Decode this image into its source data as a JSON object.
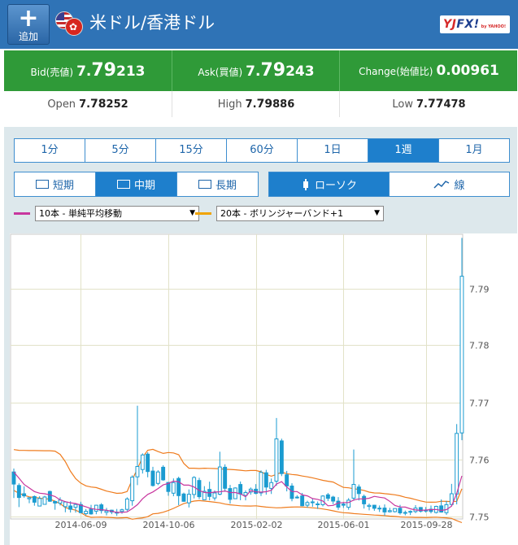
{
  "header": {
    "add_label": "追加",
    "pair_title": "米ドル/香港ドル",
    "logo_a": "YJ",
    "logo_b": "FX!",
    "logo_sub": "by YAHOO!"
  },
  "quotes": {
    "bid_label": "Bid(売値)",
    "bid_prefix": "7.",
    "bid_big": "79",
    "bid_suffix": "213",
    "ask_label": "Ask(買値)",
    "ask_prefix": "7.",
    "ask_big": "79",
    "ask_suffix": "243",
    "change_label": "Change(始値比)",
    "change_value": "0.00961"
  },
  "ohl": {
    "open_label": "Open",
    "open_prefix": "7.",
    "open_big": "78",
    "open_suffix": "252",
    "high_label": "High",
    "high_prefix": "7.",
    "high_big": "79",
    "high_suffix": "886",
    "low_label": "Low",
    "low_prefix": "7.",
    "low_big": "77",
    "low_suffix": "478"
  },
  "timeframes": [
    "1分",
    "5分",
    "15分",
    "60分",
    "1日",
    "1週",
    "1月"
  ],
  "active_timeframe": "1週",
  "range_buttons": [
    "短期",
    "中期",
    "長期"
  ],
  "active_range": "中期",
  "chart_type_buttons": [
    "ローソク",
    "線"
  ],
  "active_chart_type": "ローソク",
  "indicators": {
    "ind1": {
      "label": "10本 - 単純平均移動",
      "color": "#c8369e"
    },
    "ind2": {
      "label": "20本 - ボリンジャーバンド+1",
      "color": "#f0a400"
    }
  },
  "chart_data": {
    "type": "candlestick",
    "x_tick_labels": [
      "2014-06-09",
      "2014-10-06",
      "2015-02-02",
      "2015-06-01",
      "2015-09-28"
    ],
    "y_tick_labels": [
      "7.79",
      "7.78",
      "7.77",
      "7.76",
      "7.75"
    ],
    "y_ticks": [
      7.79,
      7.78,
      7.77,
      7.76,
      7.75
    ],
    "ylim": [
      7.7495,
      7.7995
    ],
    "x_count": 88,
    "colors": {
      "candle": "#1a9bd0",
      "sma": "#c8369e",
      "band": "#ef7c1e",
      "grid": "#e2e2c8"
    },
    "candles": [
      [
        7.75776,
        7.75563,
        7.75317,
        7.75835
      ],
      [
        7.75538,
        7.75326,
        7.75159,
        7.75576
      ],
      [
        7.75393,
        7.75356,
        7.75323,
        7.75524
      ],
      [
        7.75305,
        7.75323,
        7.75227,
        7.75335
      ],
      [
        7.75344,
        7.75244,
        7.75183,
        7.75362
      ],
      [
        7.75177,
        7.7531,
        7.75171,
        7.75349
      ],
      [
        7.75208,
        7.75336,
        7.752,
        7.75358
      ],
      [
        7.75433,
        7.75262,
        7.7525,
        7.75447
      ],
      [
        7.75257,
        7.7523,
        7.75112,
        7.75275
      ],
      [
        7.75227,
        7.75281,
        7.75187,
        7.75331
      ],
      [
        7.75166,
        7.75248,
        7.75068,
        7.75264
      ],
      [
        7.75179,
        7.75121,
        7.75063,
        7.75261
      ],
      [
        7.75156,
        7.75205,
        7.75062,
        7.75215
      ],
      [
        7.75204,
        7.7506,
        7.75052,
        7.75253
      ],
      [
        7.75043,
        7.75085,
        7.75016,
        7.75125
      ],
      [
        7.75123,
        7.75039,
        7.75025,
        7.75198
      ],
      [
        7.75088,
        7.75192,
        7.75033,
        7.75199
      ],
      [
        7.75198,
        7.75097,
        7.75045,
        7.75228
      ],
      [
        7.75066,
        7.75092,
        7.75013,
        7.75145
      ],
      [
        7.75104,
        7.75072,
        7.75034,
        7.75113
      ],
      [
        7.75057,
        7.75067,
        7.75005,
        7.75126
      ],
      [
        7.75083,
        7.75112,
        7.75043,
        7.75131
      ],
      [
        7.75119,
        7.75302,
        7.75089,
        7.7533
      ],
      [
        7.7527,
        7.75684,
        7.75183,
        7.75716
      ],
      [
        7.75689,
        7.75871,
        7.75544,
        7.76939
      ],
      [
        7.75819,
        7.76074,
        7.75748,
        7.76102
      ],
      [
        7.76088,
        7.75782,
        7.75682,
        7.76122
      ],
      [
        7.75791,
        7.75537,
        7.75519,
        7.75866
      ],
      [
        7.75575,
        7.75776,
        7.75545,
        7.75806
      ],
      [
        7.75859,
        7.75637,
        7.75621,
        7.75893
      ],
      [
        7.75591,
        7.75432,
        7.75358,
        7.75597
      ],
      [
        7.75403,
        7.75589,
        7.75349,
        7.75662
      ],
      [
        7.75662,
        7.75361,
        7.75193,
        7.75692
      ],
      [
        7.75388,
        7.7526,
        7.75251,
        7.75413
      ],
      [
        7.75233,
        7.75385,
        7.75152,
        7.75469
      ],
      [
        7.75381,
        7.75679,
        7.75311,
        7.75701
      ],
      [
        7.75626,
        7.75342,
        7.753,
        7.75673
      ],
      [
        7.75288,
        7.75436,
        7.7528,
        7.75526
      ],
      [
        7.75469,
        7.75346,
        7.75277,
        7.75605
      ],
      [
        7.75319,
        7.75407,
        7.75273,
        7.75451
      ],
      [
        7.75386,
        7.75863,
        7.75365,
        7.76131
      ],
      [
        7.75858,
        7.75488,
        7.75427,
        7.7591
      ],
      [
        7.75485,
        7.75295,
        7.75219,
        7.75549
      ],
      [
        7.75305,
        7.75494,
        7.75301,
        7.75505
      ],
      [
        7.75555,
        7.75388,
        7.75279,
        7.75608
      ],
      [
        7.75365,
        7.75415,
        7.75277,
        7.75452
      ],
      [
        7.75423,
        7.75475,
        7.75376,
        7.75503
      ],
      [
        7.75473,
        7.754,
        7.75383,
        7.75562
      ],
      [
        7.75408,
        7.75769,
        7.75354,
        7.75804
      ],
      [
        7.75761,
        7.7551,
        7.75377,
        7.75813
      ],
      [
        7.75486,
        7.75588,
        7.75389,
        7.7566
      ],
      [
        7.75614,
        7.76356,
        7.75532,
        7.76724
      ],
      [
        7.76322,
        7.75747,
        7.75703,
        7.7636
      ],
      [
        7.75726,
        7.7553,
        7.75435,
        7.75794
      ],
      [
        7.75529,
        7.75311,
        7.7526,
        7.75577
      ],
      [
        7.75332,
        7.75335,
        7.75308,
        7.75368
      ],
      [
        7.75354,
        7.75182,
        7.75174,
        7.75408
      ],
      [
        7.75191,
        7.75238,
        7.75152,
        7.75269
      ],
      [
        7.7525,
        7.75238,
        7.75165,
        7.7531
      ],
      [
        7.75214,
        7.7521,
        7.75127,
        7.75257
      ],
      [
        7.75201,
        7.75353,
        7.75172,
        7.75367
      ],
      [
        7.75375,
        7.75313,
        7.75266,
        7.75406
      ],
      [
        7.75334,
        7.75264,
        7.75209,
        7.75357
      ],
      [
        7.75263,
        7.75158,
        7.7511,
        7.75334
      ],
      [
        7.75212,
        7.75192,
        7.75145,
        7.75247
      ],
      [
        7.75155,
        7.7528,
        7.75112,
        7.75316
      ],
      [
        7.75316,
        7.75557,
        7.7527,
        7.76169
      ],
      [
        7.75512,
        7.75396,
        7.75274,
        7.75556
      ],
      [
        7.75347,
        7.75216,
        7.75133,
        7.75379
      ],
      [
        7.75171,
        7.75189,
        7.75101,
        7.75222
      ],
      [
        7.75192,
        7.75138,
        7.75094,
        7.75198
      ],
      [
        7.75138,
        7.7514,
        7.75073,
        7.75187
      ],
      [
        7.75141,
        7.75073,
        7.75008,
        7.75206
      ],
      [
        7.75078,
        7.75096,
        7.75063,
        7.75146
      ],
      [
        7.75079,
        7.75133,
        7.75064,
        7.75134
      ],
      [
        7.75139,
        7.75058,
        7.75026,
        7.75199
      ],
      [
        7.75064,
        7.75059,
        7.75014,
        7.75097
      ],
      [
        7.75083,
        7.75071,
        7.75019,
        7.75101
      ],
      [
        7.7508,
        7.75141,
        7.75054,
        7.75192
      ],
      [
        7.75152,
        7.75088,
        7.75063,
        7.7516
      ],
      [
        7.75103,
        7.75093,
        7.75062,
        7.75161
      ],
      [
        7.75122,
        7.75082,
        7.75048,
        7.75186
      ],
      [
        7.75065,
        7.75172,
        7.75047,
        7.75183
      ],
      [
        7.7518,
        7.75072,
        7.75061,
        7.75293
      ],
      [
        7.7506,
        7.75201,
        7.75024,
        7.75267
      ],
      [
        7.75204,
        7.75393,
        7.75183,
        7.75566
      ],
      [
        7.75389,
        7.76453,
        7.75206,
        7.76617
      ],
      [
        7.76461,
        7.79213,
        7.76334,
        7.79886
      ]
    ],
    "sma": [
      7.75776,
      7.75669,
      7.75556,
      7.75495,
      7.75432,
      7.75403,
      7.75393,
      7.75375,
      7.75345,
      7.75285,
      7.75254,
      7.75234,
      7.75221,
      7.75193,
      7.75163,
      7.75133,
      7.75118,
      7.75112,
      7.75104,
      7.75084,
      7.75066,
      7.75066,
      7.75075,
      7.75133,
      7.75202,
      7.75304,
      7.75382,
      7.75425,
      7.75484,
      7.75548,
      7.75575,
      7.75615,
      7.75605,
      7.75544,
      7.75544,
      7.75512,
      7.7545,
      7.75416,
      7.75409,
      7.75423,
      7.75427,
      7.75442,
      7.75415,
      7.75415,
      7.75392,
      7.75342,
      7.7545,
      7.75426,
      7.75422,
      7.75428,
      7.75455,
      7.75563,
      7.75606,
      7.75511,
      7.75432,
      7.75432,
      7.75373,
      7.75356,
      7.75308,
      7.75295,
      7.75266,
      7.75182,
      7.75189,
      7.75232,
      7.75238,
      7.75238,
      7.75283,
      7.75303,
      7.75303,
      7.75315,
      7.75347,
      7.75331,
      7.75318,
      7.7526,
      7.75186,
      7.75161,
      7.75158,
      7.75128,
      7.75108,
      7.75101,
      7.75107,
      7.75115,
      7.75117,
      7.751,
      7.75115,
      7.75175,
      7.75402,
      7.75707
    ],
    "band_upper": [
      7.76168,
      7.76156,
      7.76154,
      7.76152,
      7.76152,
      7.7615,
      7.76148,
      7.76148,
      7.76142,
      7.76084,
      7.75957,
      7.75787,
      7.7566,
      7.7558,
      7.75532,
      7.75512,
      7.75501,
      7.75471,
      7.7544,
      7.7542,
      7.754,
      7.75406,
      7.75431,
      7.75643,
      7.75831,
      7.76032,
      7.76157,
      7.76173,
      7.76134,
      7.76102,
      7.76117,
      7.7611,
      7.76078,
      7.75926,
      7.75842,
      7.75841,
      7.75836,
      7.75841,
      7.75838,
      7.75836,
      7.75831,
      7.75823,
      7.7582,
      7.75815,
      7.75806,
      7.75796,
      7.75801,
      7.75801,
      7.75778,
      7.75733,
      7.75701,
      7.75733,
      7.75771,
      7.75745,
      7.75732,
      7.75723,
      7.75705,
      7.7569,
      7.75673,
      7.75651,
      7.75628,
      7.75613,
      7.75599,
      7.7555,
      7.75504,
      7.75497,
      7.75482,
      7.75468,
      7.75451,
      7.75422,
      7.75407,
      7.75405,
      7.75395,
      7.75386,
      7.75374,
      7.75357,
      7.75331,
      7.75315,
      7.7529,
      7.75267,
      7.75247,
      7.75245,
      7.75246,
      7.75262,
      7.75259,
      7.75256,
      7.7526,
      7.7548
    ],
    "band_lower": [
      7.75451,
      7.754,
      7.75367,
      7.75339,
      7.75328,
      7.75317,
      7.75305,
      7.753,
      7.7526,
      7.7522,
      7.75151,
      7.75126,
      7.75104,
      7.75063,
      7.75006,
      7.74979,
      7.74982,
      7.74984,
      7.74978,
      7.74974,
      7.74967,
      7.7497,
      7.74974,
      7.74945,
      7.7496,
      7.7497,
      7.7499,
      7.7504,
      7.75049,
      7.75069,
      7.75099,
      7.75136,
      7.75179,
      7.7522,
      7.75244,
      7.75264,
      7.75273,
      7.75264,
      7.75256,
      7.75245,
      7.75233,
      7.75211,
      7.75198,
      7.7519,
      7.75182,
      7.75178,
      7.75177,
      7.75182,
      7.7517,
      7.75159,
      7.75153,
      7.75146,
      7.75148,
      7.75156,
      7.75159,
      7.75162,
      7.7516,
      7.75154,
      7.75146,
      7.75138,
      7.75126,
      7.75111,
      7.75093,
      7.75075,
      7.7506,
      7.75056,
      7.75044,
      7.75038,
      7.75032,
      7.75025,
      7.75018,
      7.75014,
      7.75008,
      7.75,
      7.74994,
      7.74986,
      7.74982,
      7.7498,
      7.74977,
      7.74977,
      7.74975,
      7.74979,
      7.74981,
      7.74975,
      7.7497,
      7.7496,
      7.7492,
      7.74886
    ]
  }
}
